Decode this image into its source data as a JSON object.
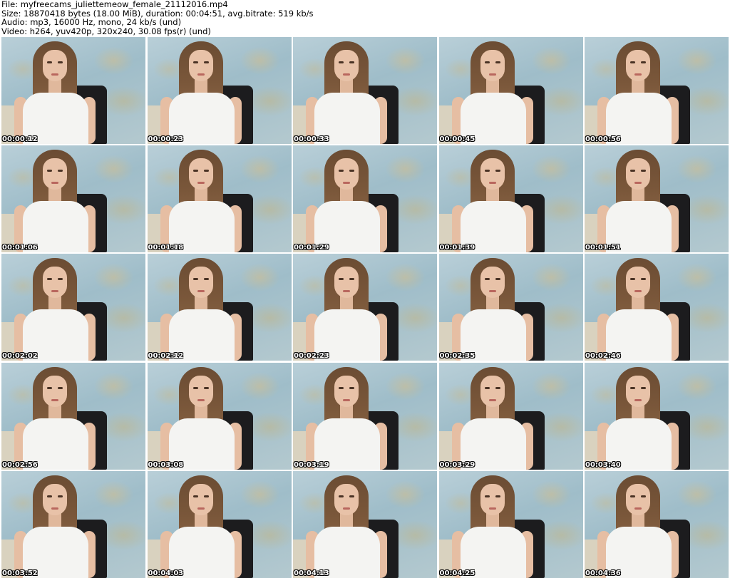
{
  "header": {
    "file": "File: myfreecams_juliettemeow_female_21112016.mp4",
    "size": "Size: 18870418 bytes (18.00 MiB), duration: 00:04:51, avg.bitrate: 519 kb/s",
    "audio": "Audio: mp3, 16000 Hz, mono, 24 kb/s (und)",
    "video": "Video: h264, yuv420p, 320x240, 30.08 fps(r) (und)"
  },
  "thumbnails": [
    {
      "timestamp": "00:00:12"
    },
    {
      "timestamp": "00:00:23"
    },
    {
      "timestamp": "00:00:33"
    },
    {
      "timestamp": "00:00:45"
    },
    {
      "timestamp": "00:00:56"
    },
    {
      "timestamp": "00:01:06"
    },
    {
      "timestamp": "00:01:18"
    },
    {
      "timestamp": "00:01:29"
    },
    {
      "timestamp": "00:01:39"
    },
    {
      "timestamp": "00:01:51"
    },
    {
      "timestamp": "00:02:02"
    },
    {
      "timestamp": "00:02:12"
    },
    {
      "timestamp": "00:02:23"
    },
    {
      "timestamp": "00:02:35"
    },
    {
      "timestamp": "00:02:46"
    },
    {
      "timestamp": "00:02:56"
    },
    {
      "timestamp": "00:03:08"
    },
    {
      "timestamp": "00:03:19"
    },
    {
      "timestamp": "00:03:29"
    },
    {
      "timestamp": "00:03:40"
    },
    {
      "timestamp": "00:03:52"
    },
    {
      "timestamp": "00:04:03"
    },
    {
      "timestamp": "00:04:13"
    },
    {
      "timestamp": "00:04:25"
    },
    {
      "timestamp": "00:04:36"
    }
  ]
}
